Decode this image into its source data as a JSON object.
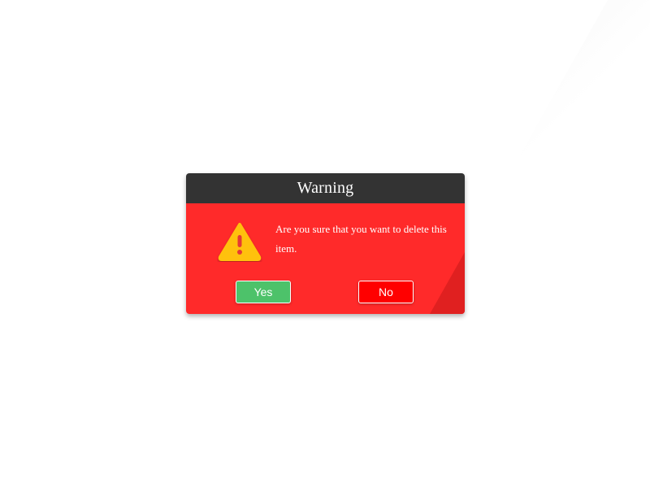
{
  "dialog": {
    "title": "Warning",
    "message": "Are you sure that you want to delete this item.",
    "icon": "warning-triangle-icon",
    "yes_label": "Yes",
    "no_label": "No"
  },
  "colors": {
    "header_bg": "#333333",
    "body_bg": "#ff2a2a",
    "yes_bg": "#4dc26a",
    "no_bg": "#ff0000",
    "icon_fill": "#ffc107",
    "icon_mark": "#e53935"
  }
}
